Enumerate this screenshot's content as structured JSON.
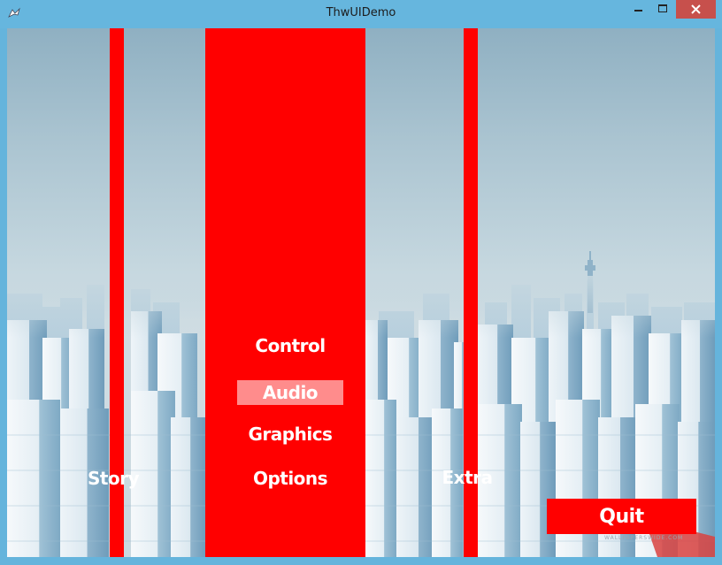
{
  "window": {
    "title": "ThwUIDemo",
    "accent": "#66b6de",
    "close_color": "#c7504c"
  },
  "menu": {
    "story": "Story",
    "options": "Options",
    "extra": "Extra",
    "submenu": {
      "control": "Control",
      "audio": "Audio",
      "graphics": "Graphics"
    },
    "quit": "Quit",
    "bar_color": "#ff0000",
    "highlight_color": "#ff8c8c"
  },
  "background": {
    "watermark": "WALLPAPERSWIDE.COM"
  }
}
